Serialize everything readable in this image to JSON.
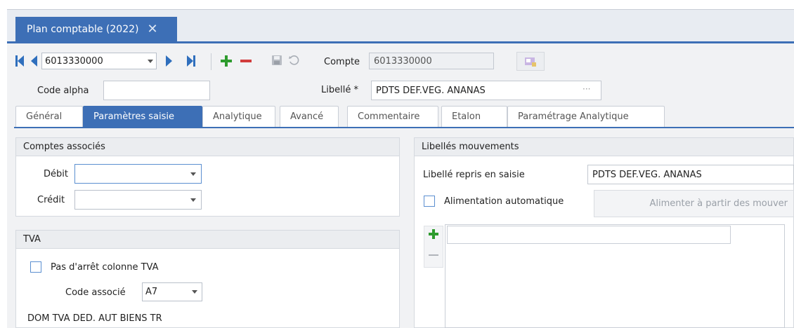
{
  "document_tab": {
    "title": "Plan comptable (2022)",
    "close_glyph": "✕"
  },
  "toolbar": {
    "account_selector": "6013330000",
    "compte_label": "Compte",
    "compte_value": "6013330000"
  },
  "header": {
    "code_alpha_label": "Code alpha",
    "code_alpha_value": "",
    "libelle_label": "Libellé *",
    "libelle_value": "PDTS DEF.VEG. ANANAS",
    "libelle_dots": "···"
  },
  "tabs": [
    {
      "label": "Général"
    },
    {
      "label": "Paramètres saisie"
    },
    {
      "label": "Analytique"
    },
    {
      "label": "Avancé"
    },
    {
      "label": "Commentaire"
    },
    {
      "label": "Etalon"
    },
    {
      "label": "Paramétrage Analytique"
    }
  ],
  "comptes_associes": {
    "title": "Comptes associés",
    "debit_label": "Débit",
    "debit_value": "",
    "credit_label": "Crédit",
    "credit_value": ""
  },
  "tva": {
    "title": "TVA",
    "pas_arret_label": "Pas d'arrêt colonne TVA",
    "code_associe_label": "Code associé",
    "code_associe_value": "A7",
    "description": "DOM TVA DED. AUT BIENS TR"
  },
  "libelles_mouvements": {
    "title": "Libellés mouvements",
    "repris_label": "Libellé repris en saisie",
    "repris_value": "PDTS DEF.VEG. ANANAS",
    "alimentation_label": "Alimentation automatique",
    "alimenter_button": "Alimenter à partir des mouver"
  },
  "colors": {
    "accent": "#3d6fb6",
    "add_green": "#2e9b2e",
    "remove_red": "#d23c3c"
  }
}
